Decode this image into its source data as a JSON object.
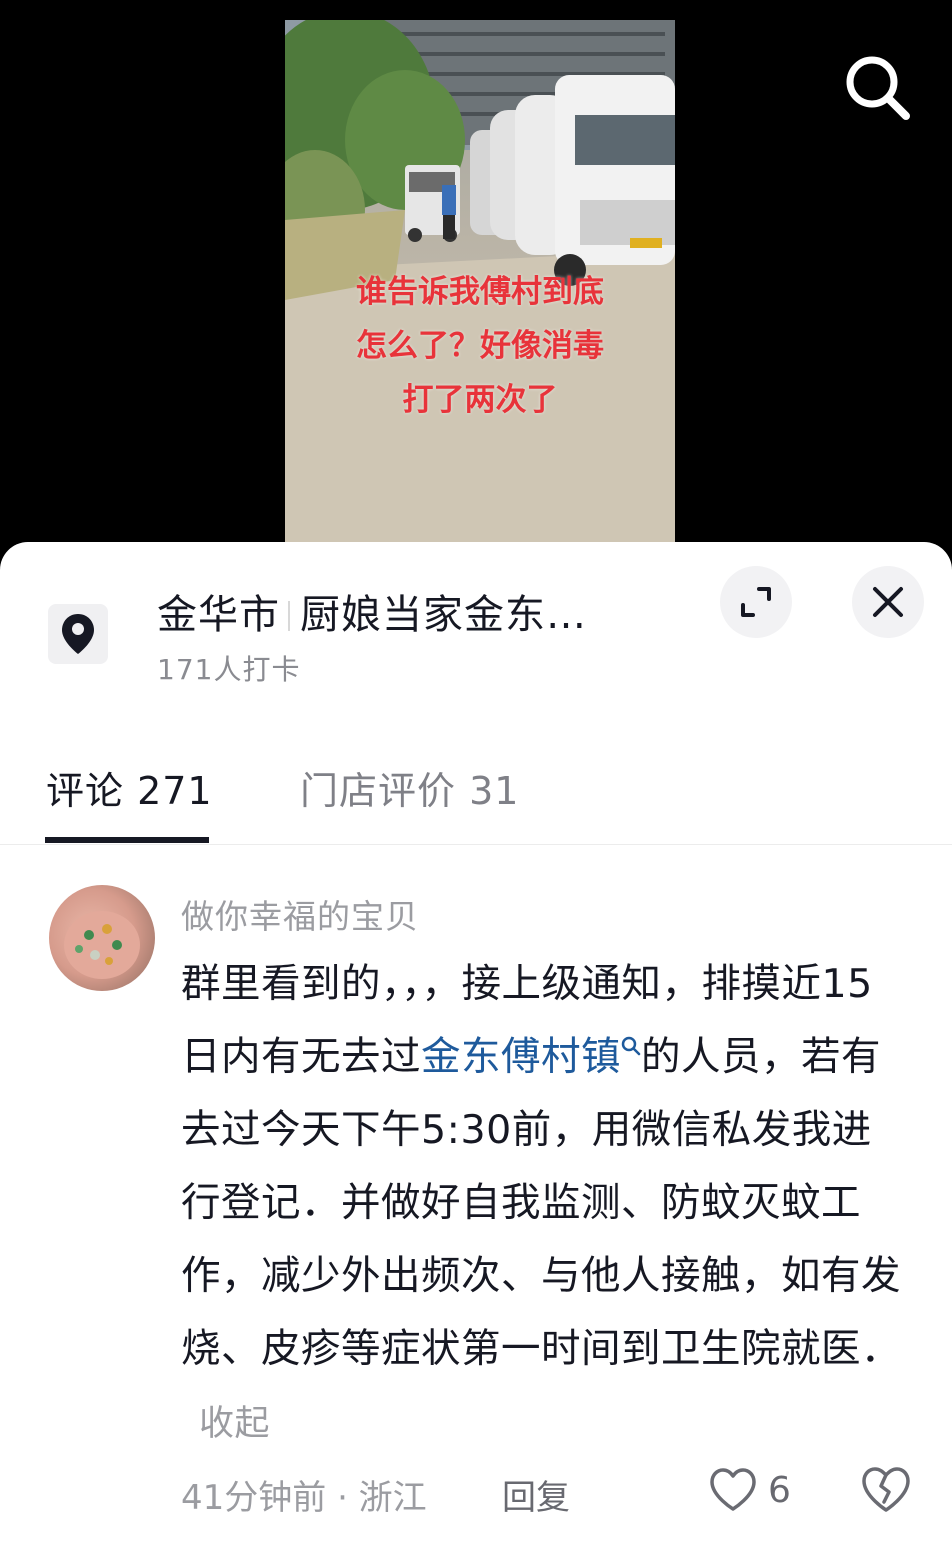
{
  "video": {
    "caption_lines": [
      "谁告诉我傅村到底",
      "怎么了？好像消毒",
      "打了两次了"
    ]
  },
  "location": {
    "city": "金华市",
    "name": "厨娘当家金东…",
    "checkins": "171人打卡"
  },
  "tabs": [
    {
      "label": "评论 271",
      "active": true
    },
    {
      "label": "门店评价 31",
      "active": false
    }
  ],
  "comment": {
    "username": "做你幸福的宝贝",
    "text_before_link": "群里看到的，，，接上级通知，排摸近15日内有无去过",
    "link_text": "金东傅村镇",
    "text_after_link": "的人员，若有去过今天下午5:30前，用微信私发我进行登记．并做好自我监测、防蚊灭蚊工作，减少外出频次、与他人接触，如有发烧、皮疹等症状第一时间到卫生院就医．",
    "collapse_label": "收起",
    "meta": "41分钟前 · 浙江",
    "reply_label": "回复",
    "like_count": "6"
  },
  "colors": {
    "link": "#1e5a9c",
    "caption": "#e8333a"
  },
  "icons": [
    "search-icon",
    "location-pin-icon",
    "expand-icon",
    "close-icon",
    "heart-icon",
    "broken-heart-icon"
  ]
}
